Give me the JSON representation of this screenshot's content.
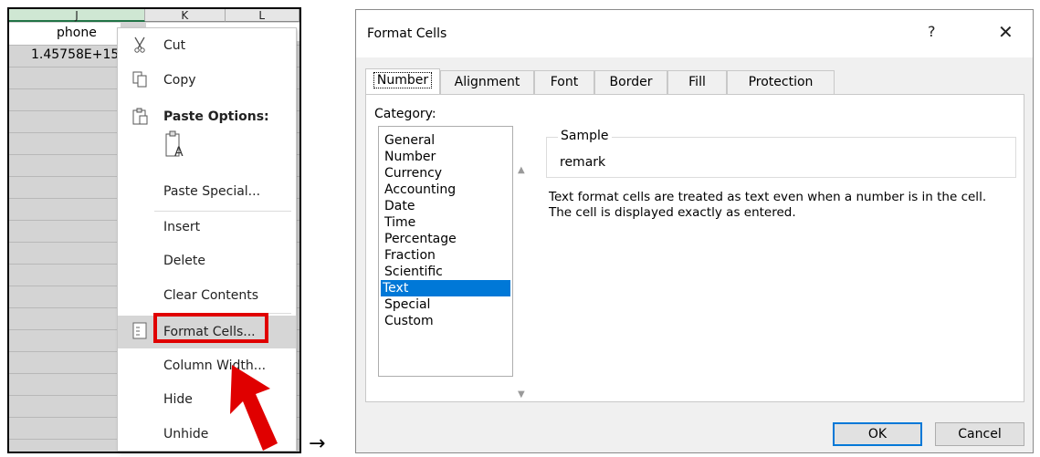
{
  "sheet": {
    "columns": [
      "J",
      "K",
      "L"
    ],
    "header_cell": "phone",
    "value_cell": "1.45758E+15"
  },
  "context_menu": {
    "items": [
      {
        "label": "Cut",
        "icon": "scissors-icon"
      },
      {
        "label": "Copy",
        "icon": "copy-icon"
      },
      {
        "label": "Paste Options:",
        "icon": "paste-icon"
      },
      {
        "label": "Paste Special..."
      },
      {
        "label": "Insert"
      },
      {
        "label": "Delete"
      },
      {
        "label": "Clear Contents"
      },
      {
        "label": "Format Cells...",
        "icon": "format-cells-icon"
      },
      {
        "label": "Column Width..."
      },
      {
        "label": "Hide"
      },
      {
        "label": "Unhide"
      }
    ],
    "paste_sub_icon": "paste-as-text-icon"
  },
  "arrow_symbol": "→",
  "dialog": {
    "title": "Format Cells",
    "help": "?",
    "close": "✕",
    "tabs": [
      "Number",
      "Alignment",
      "Font",
      "Border",
      "Fill",
      "Protection"
    ],
    "active_tab": "Number",
    "category_label": "Category:",
    "categories": [
      "General",
      "Number",
      "Currency",
      "Accounting",
      "Date",
      "Time",
      "Percentage",
      "Fraction",
      "Scientific",
      "Text",
      "Special",
      "Custom"
    ],
    "selected_category": "Text",
    "sample_label": "Sample",
    "sample_value": "remark",
    "description_line1": "Text format cells are treated as text even when a number is in the cell.",
    "description_line2": "The cell is displayed exactly as entered.",
    "ok_label": "OK",
    "cancel_label": "Cancel"
  },
  "colors": {
    "highlight_box": "#e00000",
    "selected_category_bg": "#0078d7",
    "red_arrow": "#e00000"
  }
}
